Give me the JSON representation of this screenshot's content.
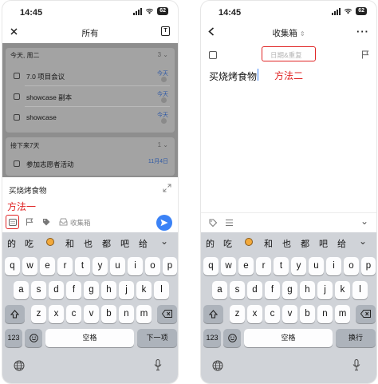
{
  "left": {
    "status_time": "14:45",
    "battery": "62",
    "nav_title": "所有",
    "groups": [
      {
        "header": "今天, 周二",
        "count": "3",
        "tasks": [
          {
            "title": "7.0 项目会议",
            "date": "今天"
          },
          {
            "title": "showcase 副本",
            "date": "今天"
          },
          {
            "title": "showcase",
            "date": "今天"
          }
        ]
      },
      {
        "header": "接下来7天",
        "count": "1",
        "tasks": [
          {
            "title": "参加志愿者活动",
            "date": "11月4日"
          }
        ]
      }
    ],
    "input_text": "买烧烤食物",
    "method_label": "方法一",
    "list_label": "收集箱",
    "keyboard": {
      "candidates": [
        "的",
        "吃",
        "和",
        "也",
        "都",
        "吧",
        "给"
      ],
      "row1": [
        "q",
        "w",
        "e",
        "r",
        "t",
        "y",
        "u",
        "i",
        "o",
        "p"
      ],
      "row2": [
        "a",
        "s",
        "d",
        "f",
        "g",
        "h",
        "j",
        "k",
        "l"
      ],
      "row3": [
        "z",
        "x",
        "c",
        "v",
        "b",
        "n",
        "m"
      ],
      "num_key": "123",
      "space": "空格",
      "return": "下一项"
    }
  },
  "right": {
    "status_time": "14:45",
    "battery": "62",
    "nav_title": "收集箱",
    "date_placeholder": "日期&重复",
    "task_title": "买烧烤食物",
    "method_label": "方法二",
    "keyboard": {
      "candidates": [
        "的",
        "吃",
        "和",
        "也",
        "都",
        "吧",
        "给"
      ],
      "row1": [
        "q",
        "w",
        "e",
        "r",
        "t",
        "y",
        "u",
        "i",
        "o",
        "p"
      ],
      "row2": [
        "a",
        "s",
        "d",
        "f",
        "g",
        "h",
        "j",
        "k",
        "l"
      ],
      "row3": [
        "z",
        "x",
        "c",
        "v",
        "b",
        "n",
        "m"
      ],
      "num_key": "123",
      "space": "空格",
      "return": "换行"
    }
  },
  "colors": {
    "accent": "#3b82f6",
    "annotation_red": "#e02525",
    "keyboard_bg": "#d0d3d8"
  }
}
